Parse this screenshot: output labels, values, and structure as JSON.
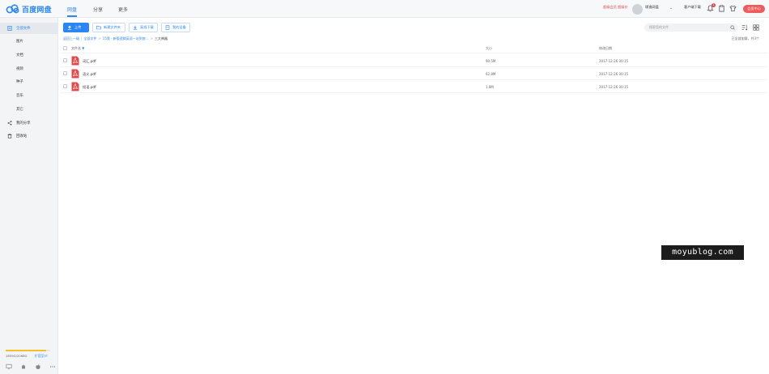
{
  "app": {
    "logo_text": "百度网盘"
  },
  "nav": {
    "items": [
      "网盘",
      "分享",
      "更多"
    ],
    "active": "网盘"
  },
  "topright": {
    "vip_link": "超级会员 超级价",
    "username": "璟逸网盘",
    "client_link": "客户端下载",
    "notification_count": "1",
    "member_button": "会员中心"
  },
  "sidebar": {
    "items": [
      "全部文件",
      "图片",
      "文档",
      "视频",
      "种子",
      "音乐",
      "其它",
      "我的分享",
      "回收站"
    ],
    "quota_text": "1859G/2068G",
    "quota_expand": "扩容至5T",
    "quota_fraction": 0.9
  },
  "toolbar": {
    "upload": "上传",
    "new_folder": "新建文件夹",
    "offline_download": "离线下载",
    "my_devices": "我的设备",
    "search_placeholder": "搜索您的文件"
  },
  "breadcrumb": {
    "items": [
      "返回上一级",
      "全部文件",
      "15我 - 新版逻辑英语一站到底..."
    ],
    "current": "三大神器"
  },
  "loaded_text": "已全部加载，共3个",
  "table": {
    "headers": {
      "name": "文件名",
      "size": "大小",
      "date": "修改日期"
    },
    "rows": [
      {
        "name": "词汇.pdf",
        "size": "90.5M",
        "date": "2017-12-26 00:15"
      },
      {
        "name": "语义.pdf",
        "size": "62.8M",
        "date": "2017-12-26 00:15"
      },
      {
        "name": "短语.pdf",
        "size": "1.8M",
        "date": "2017-12-26 00:15"
      }
    ]
  },
  "watermark": "moyublog.com",
  "colors": {
    "accent": "#2a86f5",
    "danger": "#e24a4a",
    "pdf": "#e24a4a"
  }
}
